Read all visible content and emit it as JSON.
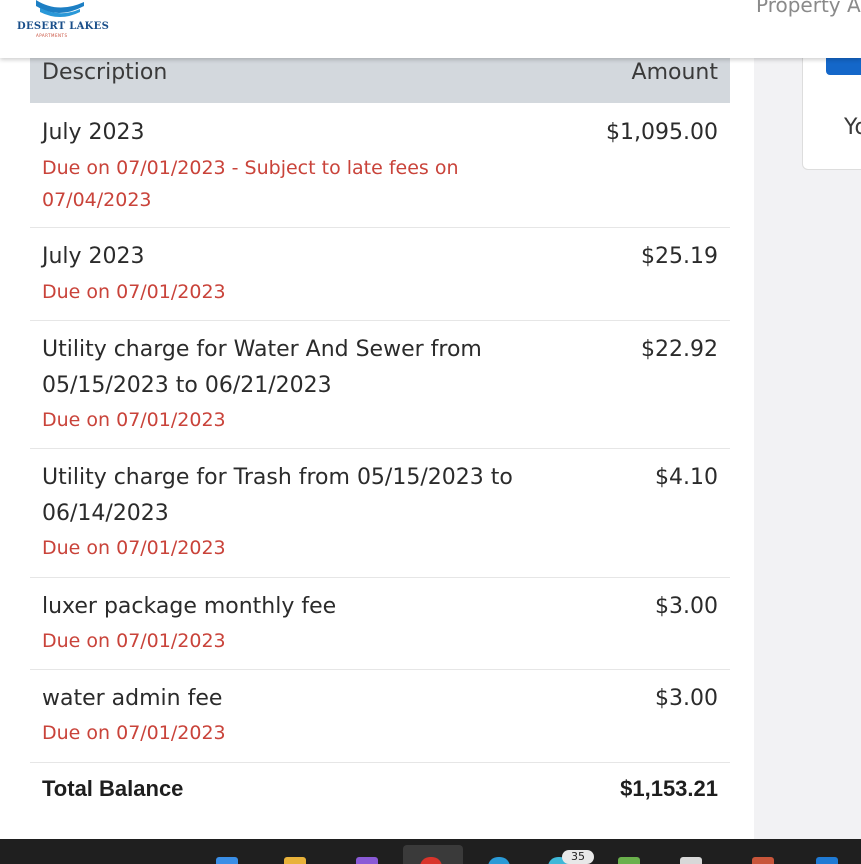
{
  "brand": {
    "name": "DESERT LAKES",
    "sub": "APARTMENTS",
    "colors": {
      "blue": "#1a4f8a",
      "red": "#c84d3a"
    }
  },
  "header": {
    "right_text": "Property A"
  },
  "side": {
    "partial_text": "Yo"
  },
  "table": {
    "col_description": "Description",
    "col_amount": "Amount",
    "rows": [
      {
        "title": "July 2023",
        "due": "Due on 07/01/2023 - Subject to late fees on 07/04/2023",
        "amount": "$1,095.00"
      },
      {
        "title": "July 2023",
        "due": "Due on 07/01/2023",
        "amount": "$25.19"
      },
      {
        "title": "Utility charge for Water And Sewer from 05/15/2023 to 06/21/2023",
        "due": "Due on 07/01/2023",
        "amount": "$22.92"
      },
      {
        "title": "Utility charge for Trash from 05/15/2023 to 06/14/2023",
        "due": "Due on 07/01/2023",
        "amount": "$4.10"
      },
      {
        "title": "luxer package monthly fee",
        "due": "Due on 07/01/2023",
        "amount": "$3.00"
      },
      {
        "title": "water admin fee",
        "due": "Due on 07/01/2023",
        "amount": "$3.00"
      }
    ],
    "total_label": "Total Balance",
    "total_amount": "$1,153.21"
  },
  "taskbar": {
    "badge_count": "35",
    "icons": [
      "windows-start-icon",
      "file-explorer-icon",
      "visual-studio-icon",
      "chrome-icon",
      "edge-icon",
      "mail-icon",
      "office-icon",
      "notepad-icon",
      "paint-icon",
      "vscode-icon"
    ]
  },
  "colors": {
    "due_red": "#c9433a",
    "header_gray": "#d3d8dd",
    "accent_blue": "#1467c9"
  }
}
